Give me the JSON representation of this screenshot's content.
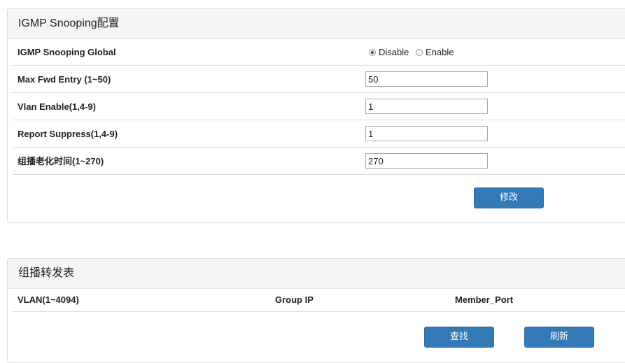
{
  "config_panel": {
    "title": "IGMP Snooping配置",
    "global": {
      "label": "IGMP Snooping Global",
      "options": [
        "Disable",
        "Enable"
      ],
      "selected": "Disable"
    },
    "max_fwd": {
      "label": "Max Fwd Entry (1~50)",
      "value": "50"
    },
    "vlan_enable": {
      "label": "Vlan Enable(1,4-9)",
      "value": "1"
    },
    "report_suppress": {
      "label": "Report Suppress(1,4-9)",
      "value": "1"
    },
    "aging_time": {
      "label": "组播老化时间(1~270)",
      "value": "270"
    },
    "modify_button": "修改"
  },
  "fwd_table_panel": {
    "title": "组播转发表",
    "columns": [
      "VLAN(1~4094)",
      "Group IP",
      "Member_Port"
    ],
    "search_button": "查找",
    "refresh_button": "刷新"
  }
}
